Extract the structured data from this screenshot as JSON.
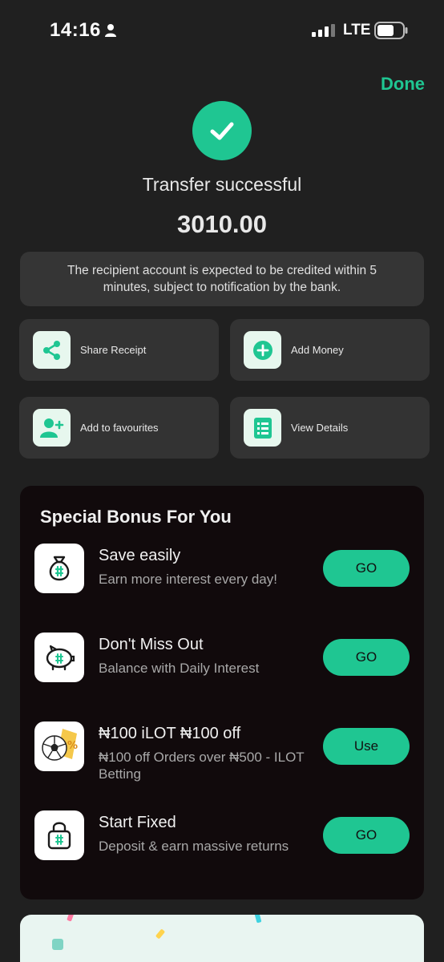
{
  "status_bar": {
    "time": "14:16",
    "network": "LTE",
    "icons": [
      "person-icon",
      "signal-icon",
      "battery-icon"
    ]
  },
  "header": {
    "done_label": "Done"
  },
  "result": {
    "title": "Transfer successful",
    "amount": "3010.00",
    "notice": "The recipient account is expected to be credited within 5 minutes, subject to notification by the bank."
  },
  "actions": [
    {
      "label": "Share Receipt",
      "icon": "share-icon"
    },
    {
      "label": "Add Money",
      "icon": "plus-circle-icon"
    },
    {
      "label": "Add to favourites",
      "icon": "add-user-icon"
    },
    {
      "label": "View Details",
      "icon": "document-icon"
    }
  ],
  "bonus": {
    "title": "Special Bonus For You",
    "items": [
      {
        "name": "Save easily",
        "desc": "Earn more interest every day!",
        "button": "GO",
        "icon": "money-bag-icon"
      },
      {
        "name": "Don't Miss Out",
        "desc": "Balance with Daily Interest",
        "button": "GO",
        "icon": "piggy-bank-icon"
      },
      {
        "name": "₦100 iLOT ₦100 off",
        "desc": "₦100 off Orders over ₦500 - ILOT Betting",
        "button": "Use",
        "icon": "soccer-ball-icon"
      },
      {
        "name": "Start Fixed",
        "desc": "Deposit & earn massive returns",
        "button": "GO",
        "icon": "lock-icon"
      }
    ]
  },
  "colors": {
    "accent": "#1fc692",
    "background": "#202020",
    "card": "#333333",
    "panel": "#110a0c"
  }
}
